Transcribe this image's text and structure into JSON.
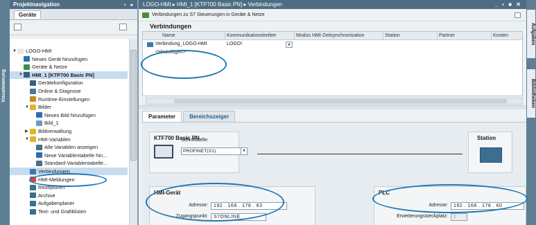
{
  "left_strip_label": "Visualisierung",
  "left_panel": {
    "title": "Projektnavigation",
    "tab": "Geräte",
    "tree": [
      {
        "label": "LOGO-HMI",
        "indent": 0,
        "expander": "▼",
        "color": "#e7e7e7"
      },
      {
        "label": "Neues Gerät hinzufügen",
        "indent": 1,
        "expander": "",
        "color": "#2c6fb1"
      },
      {
        "label": "Geräte & Netze",
        "indent": 1,
        "expander": "",
        "color": "#3f8f4b"
      },
      {
        "label": "HMI_1 [KTP700 Basic PN]",
        "indent": 1,
        "expander": "▼",
        "color": "#3a5f7d",
        "bold": true,
        "selected": true
      },
      {
        "label": "Gerätekonfiguration",
        "indent": 2,
        "expander": "",
        "color": "#3a5f7d"
      },
      {
        "label": "Online & Diagnose",
        "indent": 2,
        "expander": "",
        "color": "#4a78a0"
      },
      {
        "label": "Runtime-Einstellungen",
        "indent": 2,
        "expander": "",
        "color": "#c78a1c"
      },
      {
        "label": "Bilder",
        "indent": 2,
        "expander": "▼",
        "color": "#e0b42c"
      },
      {
        "label": "Neues Bild hinzufügen",
        "indent": 3,
        "expander": "",
        "color": "#2c6fb1"
      },
      {
        "label": "Bild_1",
        "indent": 3,
        "expander": "",
        "color": "#6a9ac4"
      },
      {
        "label": "Bildverwaltung",
        "indent": 2,
        "expander": "▶",
        "color": "#e0b42c"
      },
      {
        "label": "HMI-Variablen",
        "indent": 2,
        "expander": "▼",
        "color": "#e0b42c"
      },
      {
        "label": "Alle Variablen anzeigen",
        "indent": 3,
        "expander": "",
        "color": "#4a6f8c"
      },
      {
        "label": "Neue Variablentabelle hin...",
        "indent": 3,
        "expander": "",
        "color": "#2c6fb1"
      },
      {
        "label": "Standard-Variablentabelle...",
        "indent": 3,
        "expander": "",
        "color": "#4a6f8c"
      },
      {
        "label": "Verbindungen",
        "indent": 2,
        "expander": "",
        "color": "#3a7ab0",
        "selected": true
      },
      {
        "label": "HMI-Meldungen",
        "indent": 2,
        "expander": "",
        "color": "#d24a3a"
      },
      {
        "label": "Rezepturen",
        "indent": 2,
        "expander": "",
        "color": "#3a6f92"
      },
      {
        "label": "Archive",
        "indent": 2,
        "expander": "",
        "color": "#3a6f92"
      },
      {
        "label": "Aufgabenplaner",
        "indent": 2,
        "expander": "",
        "color": "#3a6f92"
      },
      {
        "label": "Text- und Grafiklisten",
        "indent": 2,
        "expander": "",
        "color": "#3a6f92"
      }
    ]
  },
  "main": {
    "breadcrumb": "LOGO-HMI  ▸  HMI_1 [KTP700 Basic PN]  ▸  Verbindungen",
    "window_buttons": "_ ▪ ■ ✕",
    "toolbar_text": "Verbindungen zu S7 Steuerungen in Geräte & Netze",
    "section_title": "Verbindungen",
    "columns": [
      "Name",
      "Kommunikationstreiber",
      "Modus HMI-Zeitsynchronisation",
      "Station",
      "Partner",
      "Knoten"
    ],
    "rows": [
      {
        "name": "Verbindung_LOGO-HMI",
        "driver": "LOGO!"
      },
      {
        "name": "<Hinzufügen>",
        "driver": ""
      }
    ],
    "tabs": [
      {
        "label": "Parameter",
        "active": true
      },
      {
        "label": "Bereichszeiger",
        "active": false
      }
    ],
    "device": {
      "title": "KTF700 Basic PN",
      "interface_label": "Schnittstelle:",
      "interface_value": "PROFINET(X1)"
    },
    "station": {
      "title": "Station"
    },
    "hmi_device": {
      "title": "HMI-Gerät",
      "address_label": "Adresse:",
      "address": [
        "192",
        "168",
        "178",
        "63"
      ],
      "access_label": "Zugangspunkt:",
      "access_value": "S7ONLINE"
    },
    "plc": {
      "title": "PLC",
      "address_label": "Adresse:",
      "address": [
        "192",
        "168",
        "178",
        "60"
      ],
      "slot_label": "Erweiterungssteckplatz:",
      "slot_value": "0"
    }
  },
  "right_strip": {
    "tabs": [
      "Aufgaben",
      "Bibliotheken"
    ]
  }
}
